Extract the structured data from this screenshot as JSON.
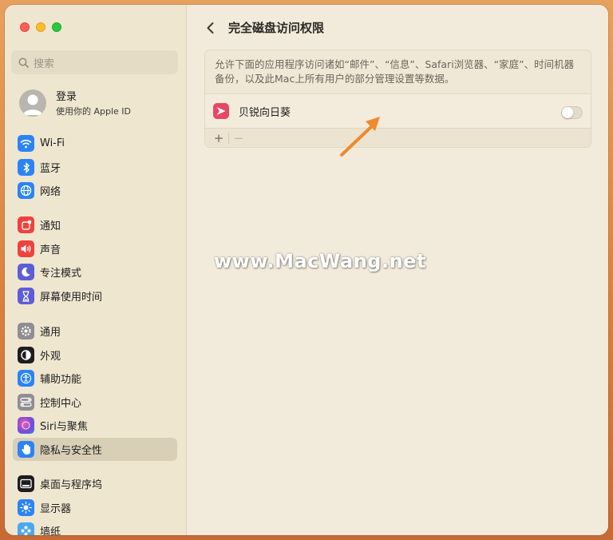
{
  "sidebar": {
    "search_placeholder": "搜索",
    "account": {
      "title": "登录",
      "subtitle": "使用你的 Apple ID"
    },
    "items": [
      {
        "label": "Wi-Fi",
        "icon": "wifi-icon",
        "color": "#2b84f6"
      },
      {
        "label": "蓝牙",
        "icon": "bluetooth-icon",
        "color": "#2b84f6"
      },
      {
        "label": "网络",
        "icon": "globe-icon",
        "color": "#2b84f6"
      },
      {
        "label": "通知",
        "icon": "bell-icon",
        "color": "#f0423c"
      },
      {
        "label": "声音",
        "icon": "speaker-icon",
        "color": "#f0423c"
      },
      {
        "label": "专注模式",
        "icon": "moon-icon",
        "color": "#5c5ed6"
      },
      {
        "label": "屏幕使用时间",
        "icon": "hourglass-icon",
        "color": "#5c5ed6"
      },
      {
        "label": "通用",
        "icon": "gear-icon",
        "color": "#8e8e93"
      },
      {
        "label": "外观",
        "icon": "appearance-icon",
        "color": "#1d1d1f"
      },
      {
        "label": "辅助功能",
        "icon": "accessibility-icon",
        "color": "#2b84f6"
      },
      {
        "label": "控制中心",
        "icon": "control-center-icon",
        "color": "#8e8e93"
      },
      {
        "label": "Siri与聚焦",
        "icon": "siri-icon",
        "color": "#7b49d6"
      },
      {
        "label": "隐私与安全性",
        "icon": "hand-icon",
        "color": "#2b84f6"
      },
      {
        "label": "桌面与程序坞",
        "icon": "dock-icon",
        "color": "#1d1d1f"
      },
      {
        "label": "显示器",
        "icon": "brightness-icon",
        "color": "#2b84f6"
      },
      {
        "label": "墙纸",
        "icon": "wallpaper-icon",
        "color": "#4aa8f0"
      }
    ],
    "selected": "隐私与安全性"
  },
  "main": {
    "title": "完全磁盘访问权限",
    "description": "允许下面的应用程序访问诸如“邮件”、“信息”、Safari浏览器、“家庭”、时间机器备份，以及此Mac上所有用户的部分管理设置等数据。",
    "apps": [
      {
        "name": "贝锐向日葵",
        "enabled": false,
        "icon_color": "#e84766"
      }
    ],
    "footer": {
      "add": "+",
      "remove": "−"
    }
  },
  "watermark": "www.MacWang.net",
  "colors": {
    "accent": "#2b84f6",
    "arrow": "#f08a2c"
  }
}
